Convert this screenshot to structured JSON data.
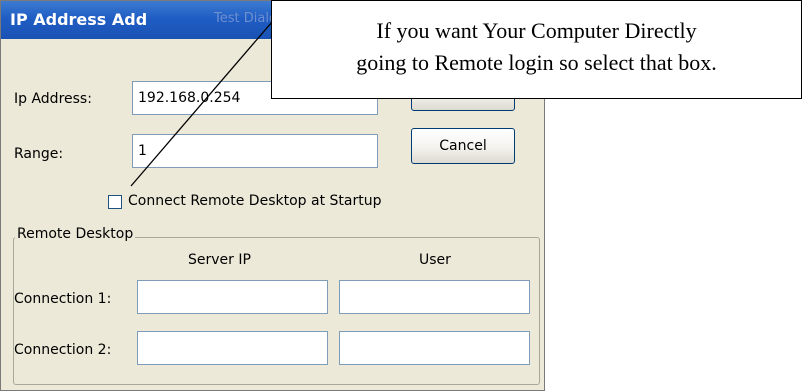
{
  "dialog": {
    "title": "IP Address Add",
    "ghost_title": "Test Dialog",
    "ip_label": "Ip Address:",
    "ip_value": "192.168.0.254",
    "range_label": "Range:",
    "range_value": "1",
    "cancel_label": "Cancel",
    "checkbox_label": "Connect Remote Desktop at Startup",
    "checkbox_checked": false
  },
  "remote_desktop": {
    "legend": "Remote Desktop",
    "server_ip_header": "Server IP",
    "user_header": "User",
    "connections": [
      {
        "label": "Connection 1:",
        "server_ip": "",
        "user": ""
      },
      {
        "label": "Connection 2:",
        "server_ip": "",
        "user": ""
      }
    ]
  },
  "callout": {
    "line1": "If you want Your Computer Directly",
    "line2": "going to Remote login so select that box."
  }
}
